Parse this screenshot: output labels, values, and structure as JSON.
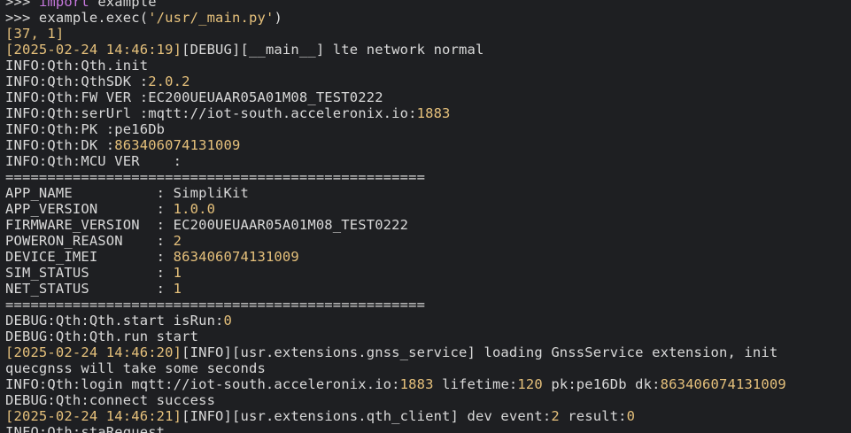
{
  "terminal": {
    "lines": [
      [
        {
          "t": ">>> ",
          "c": "text"
        },
        {
          "t": "import",
          "c": "kw"
        },
        {
          "t": " example",
          "c": "text"
        }
      ],
      [
        {
          "t": ">>> example.exec(",
          "c": "text"
        },
        {
          "t": "'/usr/_main.py'",
          "c": "str"
        },
        {
          "t": ")",
          "c": "text"
        }
      ],
      [
        {
          "t": "[37, 1]",
          "c": "br"
        }
      ],
      [
        {
          "t": "[2025-02-24 14:46:19]",
          "c": "br"
        },
        {
          "t": "[DEBUG][__main__] lte network normal",
          "c": "text"
        }
      ],
      [
        {
          "t": "INFO:Qth:Qth.init",
          "c": "text"
        }
      ],
      [
        {
          "t": "INFO:Qth:QthSDK :",
          "c": "text"
        },
        {
          "t": "2.0.2",
          "c": "num"
        }
      ],
      [
        {
          "t": "INFO:Qth:FW VER :EC200UEUAAR05A01M08_TEST0222",
          "c": "text"
        }
      ],
      [
        {
          "t": "INFO:Qth:serUrl :mqtt://iot-south.acceleronix.io:",
          "c": "text"
        },
        {
          "t": "1883",
          "c": "num"
        }
      ],
      [
        {
          "t": "INFO:Qth:PK :pe16Db",
          "c": "text"
        }
      ],
      [
        {
          "t": "INFO:Qth:DK :",
          "c": "text"
        },
        {
          "t": "863406074131009",
          "c": "num"
        }
      ],
      [
        {
          "t": "INFO:Qth:MCU VER    :",
          "c": "text"
        }
      ],
      [
        {
          "t": "==================================================",
          "c": "text"
        }
      ],
      [
        {
          "t": "APP_NAME          : SimpliKit",
          "c": "text"
        }
      ],
      [
        {
          "t": "APP_VERSION       : ",
          "c": "text"
        },
        {
          "t": "1.0.0",
          "c": "num"
        }
      ],
      [
        {
          "t": "FIRMWARE_VERSION  : EC200UEUAAR05A01M08_TEST0222",
          "c": "text"
        }
      ],
      [
        {
          "t": "POWERON_REASON    : ",
          "c": "text"
        },
        {
          "t": "2",
          "c": "num"
        }
      ],
      [
        {
          "t": "DEVICE_IMEI       : ",
          "c": "text"
        },
        {
          "t": "863406074131009",
          "c": "num"
        }
      ],
      [
        {
          "t": "SIM_STATUS        : ",
          "c": "text"
        },
        {
          "t": "1",
          "c": "num"
        }
      ],
      [
        {
          "t": "NET_STATUS        : ",
          "c": "text"
        },
        {
          "t": "1",
          "c": "num"
        }
      ],
      [
        {
          "t": "==================================================",
          "c": "text"
        }
      ],
      [
        {
          "t": "DEBUG:Qth:Qth.start isRun:",
          "c": "text"
        },
        {
          "t": "0",
          "c": "num"
        }
      ],
      [
        {
          "t": "DEBUG:Qth:Qth.run start",
          "c": "text"
        }
      ],
      [
        {
          "t": "[2025-02-24 14:46:20]",
          "c": "br"
        },
        {
          "t": "[INFO][usr.extensions.gnss_service] loading GnssService extension, init",
          "c": "text"
        }
      ],
      [
        {
          "t": "quecgnss will take some seconds",
          "c": "text"
        }
      ],
      [
        {
          "t": "INFO:Qth:login mqtt://iot-south.acceleronix.io:",
          "c": "text"
        },
        {
          "t": "1883",
          "c": "num"
        },
        {
          "t": " lifetime:",
          "c": "text"
        },
        {
          "t": "120",
          "c": "num"
        },
        {
          "t": " pk:pe16Db dk:",
          "c": "text"
        },
        {
          "t": "863406074131009",
          "c": "num"
        }
      ],
      [
        {
          "t": "DEBUG:Qth:connect success",
          "c": "text"
        }
      ],
      [
        {
          "t": "[2025-02-24 14:46:21]",
          "c": "br"
        },
        {
          "t": "[INFO][usr.extensions.qth_client] dev event:",
          "c": "text"
        },
        {
          "t": "2",
          "c": "num"
        },
        {
          "t": " result:",
          "c": "text"
        },
        {
          "t": "0",
          "c": "num"
        }
      ],
      [
        {
          "t": "INFO:Qth:staRequest",
          "c": "text"
        }
      ]
    ],
    "colors": {
      "background": "#1e1f22",
      "text": "#d9d9d9",
      "keyword": "#c678dd",
      "string": "#e5c07b",
      "number": "#e5c07b"
    }
  }
}
